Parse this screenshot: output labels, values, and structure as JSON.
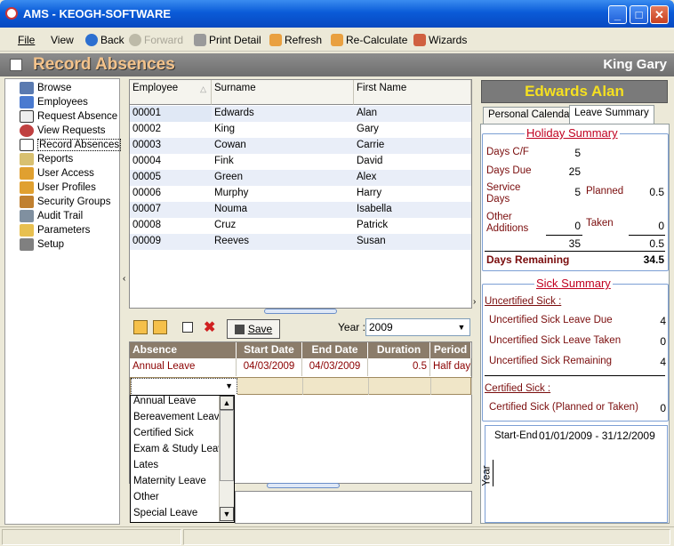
{
  "window": {
    "title": "AMS - KEOGH-SOFTWARE"
  },
  "toolbar": {
    "file": "File",
    "view": "View",
    "back": "Back",
    "forward": "Forward",
    "print_detail": "Print Detail",
    "refresh": "Refresh",
    "recalculate": "Re-Calculate",
    "wizards": "Wizards"
  },
  "header": {
    "page_title": "Record Absences",
    "user": "King Gary"
  },
  "nav": {
    "items": [
      "Browse",
      "Employees",
      "Request Absence",
      "View Requests",
      "Record Absences",
      "Reports",
      "User Access",
      "User Profiles",
      "Security Groups",
      "Audit Trail",
      "Parameters",
      "Setup"
    ],
    "selected": "Record Absences"
  },
  "employees": {
    "columns": [
      "Employee",
      "Surname",
      "First Name"
    ],
    "rows": [
      [
        "00001",
        "Edwards",
        "Alan"
      ],
      [
        "00002",
        "King",
        "Gary"
      ],
      [
        "00003",
        "Cowan",
        "Carrie"
      ],
      [
        "00004",
        "Fink",
        "David"
      ],
      [
        "00005",
        "Green",
        "Alex"
      ],
      [
        "00006",
        "Murphy",
        "Harry"
      ],
      [
        "00007",
        "Nouma",
        "Isabella"
      ],
      [
        "00008",
        "Cruz",
        "Patrick"
      ],
      [
        "00009",
        "Reeves",
        "Susan"
      ]
    ]
  },
  "absence_toolbar": {
    "save": "Save",
    "year_label": "Year :",
    "year": "2009"
  },
  "absences": {
    "columns": [
      "Absence",
      "Start Date",
      "End Date",
      "Duration",
      "Period"
    ],
    "rows": [
      [
        "Annual Leave",
        "04/03/2009",
        "04/03/2009",
        "0.5",
        "Half day"
      ]
    ]
  },
  "absence_types": [
    "Annual Leave",
    "Bereavement Leave",
    "Certified Sick",
    "Exam & Study Leave",
    "Lates",
    "Maternity Leave",
    "Other",
    "Special Leave"
  ],
  "right": {
    "employee_name": "Edwards Alan",
    "tabs": [
      "Personal Calendar",
      "Leave Summary"
    ],
    "holiday": {
      "title": "Holiday Summary",
      "days_cf_label": "Days C/F",
      "days_cf": "5",
      "days_due_label": "Days Due",
      "days_due": "25",
      "service_label": "Service Days",
      "service": "5",
      "planned_label": "Planned",
      "planned": "0.5",
      "other_label": "Other Additions",
      "other": "0",
      "taken_label": "Taken",
      "taken": "0",
      "total_left": "35",
      "total_right": "0.5",
      "remaining_label": "Days Remaining",
      "remaining": "34.5"
    },
    "sick": {
      "title": "Sick Summary",
      "uncertified_heading": "Uncertified Sick :",
      "due_label": "Uncertified Sick Leave Due",
      "due": "4",
      "taken_label": "Uncertified Sick Leave Taken",
      "taken": "0",
      "remaining_label": "Uncertified Sick Remaining",
      "remaining": "4",
      "certified_heading": "Certified Sick :",
      "cert_label": "Certified Sick (Planned or Taken)",
      "cert": "0"
    },
    "calendar": {
      "start_end_label": "Start-End",
      "range": "01/01/2009 - 31/12/2009",
      "axis": "Year"
    }
  }
}
